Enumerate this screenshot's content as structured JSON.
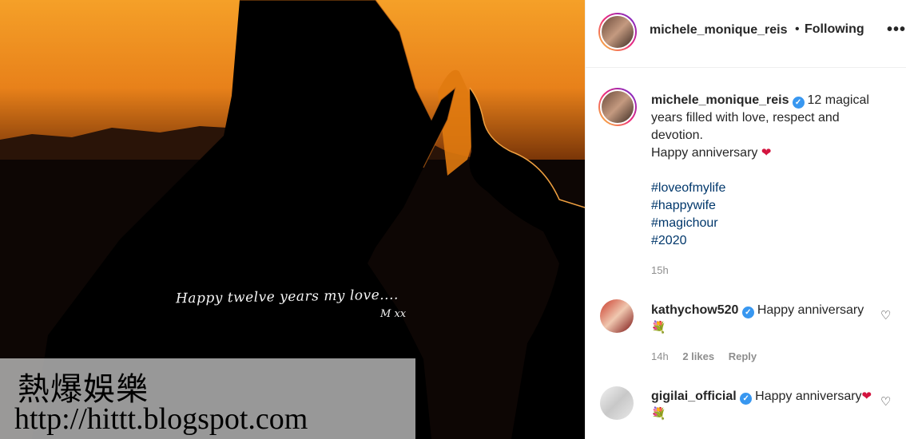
{
  "photo": {
    "overlay_line1": "Happy twelve years my love....",
    "overlay_line2": "M xx"
  },
  "watermark": {
    "title": "熱爆娛樂",
    "url": "http://hittt.blogspot.com"
  },
  "header": {
    "username": "michele_monique_reis",
    "separator": "•",
    "follow_status": "Following",
    "more_icon": "•••"
  },
  "caption": {
    "username": "michele_monique_reis",
    "text": "12 magical years filled with love, respect and devotion.",
    "line2": "Happy anniversary",
    "hashtags": [
      "#loveofmylife",
      "#happywife",
      "#magichour",
      "#2020"
    ],
    "time": "15h"
  },
  "comments": [
    {
      "username": "kathychow520",
      "text": "Happy anniversary",
      "time": "14h",
      "likes": "2 likes",
      "reply": "Reply"
    },
    {
      "username": "gigilai_official",
      "text": "Happy anniversary"
    }
  ]
}
